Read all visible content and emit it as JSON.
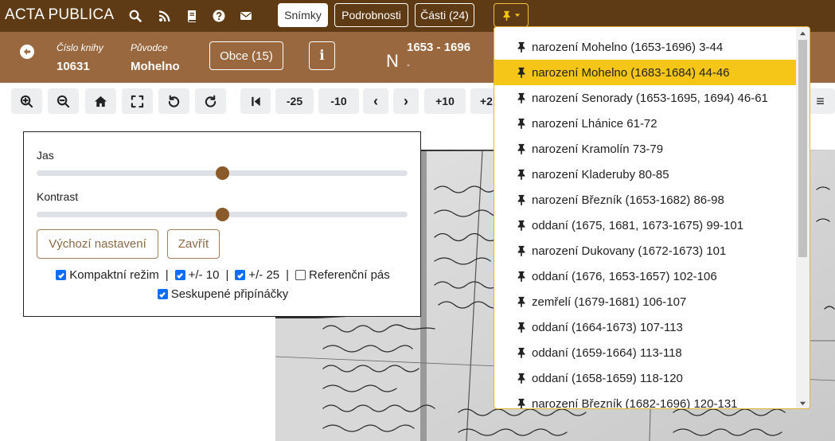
{
  "navbar": {
    "brand": "ACTA PUBLICA",
    "icons": [
      "search-icon",
      "rss-icon",
      "book-icon",
      "help-icon",
      "envelope-icon"
    ],
    "tabs": [
      {
        "label": "Snímky",
        "active": true
      },
      {
        "label": "Podrobnosti",
        "active": false
      },
      {
        "label": "Části (24)",
        "active": false
      }
    ]
  },
  "info": {
    "book_label": "Číslo knihy",
    "book_value": "10631",
    "origin_label": "Původce",
    "origin_value": "Mohelno",
    "obce_button": "Obce (15)",
    "info_button": "i",
    "letter": "N",
    "years": "1653 - 1696",
    "years_sub": "-"
  },
  "toolbar": {
    "icons": [
      "zoom-in-icon",
      "zoom-out-icon",
      "home-icon",
      "fullscreen-icon",
      "rotate-left-icon",
      "rotate-right-icon",
      "first-page-icon"
    ],
    "jumps": [
      "-25",
      "-10",
      "‹",
      "›",
      "+10",
      "+2"
    ]
  },
  "panel": {
    "brightness_label": "Jas",
    "brightness_value": 0.5,
    "contrast_label": "Kontrast",
    "contrast_value": 0.5,
    "reset_button": "Výchozí nastavení",
    "close_button": "Zavřít",
    "options": [
      {
        "label": "Kompaktní režim",
        "checked": true
      },
      {
        "label": "+/- 10",
        "checked": true
      },
      {
        "label": "+/- 25",
        "checked": true
      },
      {
        "label": "Referenční pás",
        "checked": false
      }
    ],
    "grouped_option": {
      "label": "Seskupené připínáčky",
      "checked": true
    },
    "separator": "|"
  },
  "dropdown": {
    "items": [
      "narození Mohelno (1653-1696) 3-44",
      "narození Mohelno (1683-1684) 44-46",
      "narození Senorady (1653-1695, 1694) 46-61",
      "narození Lhánice 61-72",
      "narození Kramolín 73-79",
      "narození Kladeruby 80-85",
      "narození Březník (1653-1682) 86-98",
      "oddaní (1675, 1681, 1673-1675) 99-101",
      "narození Dukovany (1672-1673) 101",
      "oddaní (1676, 1653-1657) 102-106",
      "zemřelí (1679-1681) 106-107",
      "oddaní (1664-1673) 107-113",
      "oddaní (1659-1664) 113-118",
      "oddaní (1658-1659) 118-120",
      "narození Březník (1682-1696) 120-131"
    ],
    "active_index": 1
  },
  "colors": {
    "navbar": "#5e3b14",
    "infobar": "#99683f",
    "highlight": "#f5c518",
    "checkbox": "#0d6efd"
  }
}
